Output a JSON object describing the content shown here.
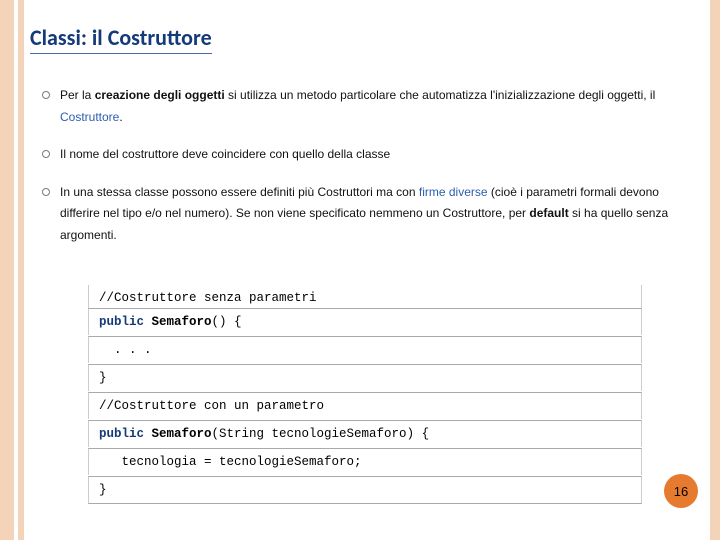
{
  "title": "Classi: il Costruttore",
  "bullets": {
    "b1": {
      "pre": "Per la ",
      "strong": "creazione degli oggetti",
      "post1": " si utilizza un metodo particolare che automatizza l'inizializzazione degli oggetti, il ",
      "blue": "Costruttore",
      "post2": "."
    },
    "b2": "Il nome del costruttore deve coincidere con quello della classe",
    "b3": {
      "pre": "In una stessa classe possono essere definiti più Costruttori ma con ",
      "blue": "firme diverse",
      "mid": " (cioè i parametri formali devono differire nel tipo e/o nel numero). Se non viene specificato nemmeno un Costruttore, per ",
      "bold": "default",
      "post": " si ha quello senza argomenti."
    }
  },
  "code": {
    "r0": "//Costruttore senza parametri",
    "r1_kw": "public",
    "r1_cls": " Semaforo",
    "r1_rest": "() {",
    "r2": "  . . .",
    "r3": "}",
    "r4": "//Costruttore con un parametro",
    "r5_kw": "public",
    "r5_cls": " Semaforo",
    "r5_rest": "(String tecnologieSemaforo) {",
    "r6": "   tecnologia = tecnologieSemaforo;",
    "r7": "}"
  },
  "page_number": "16"
}
